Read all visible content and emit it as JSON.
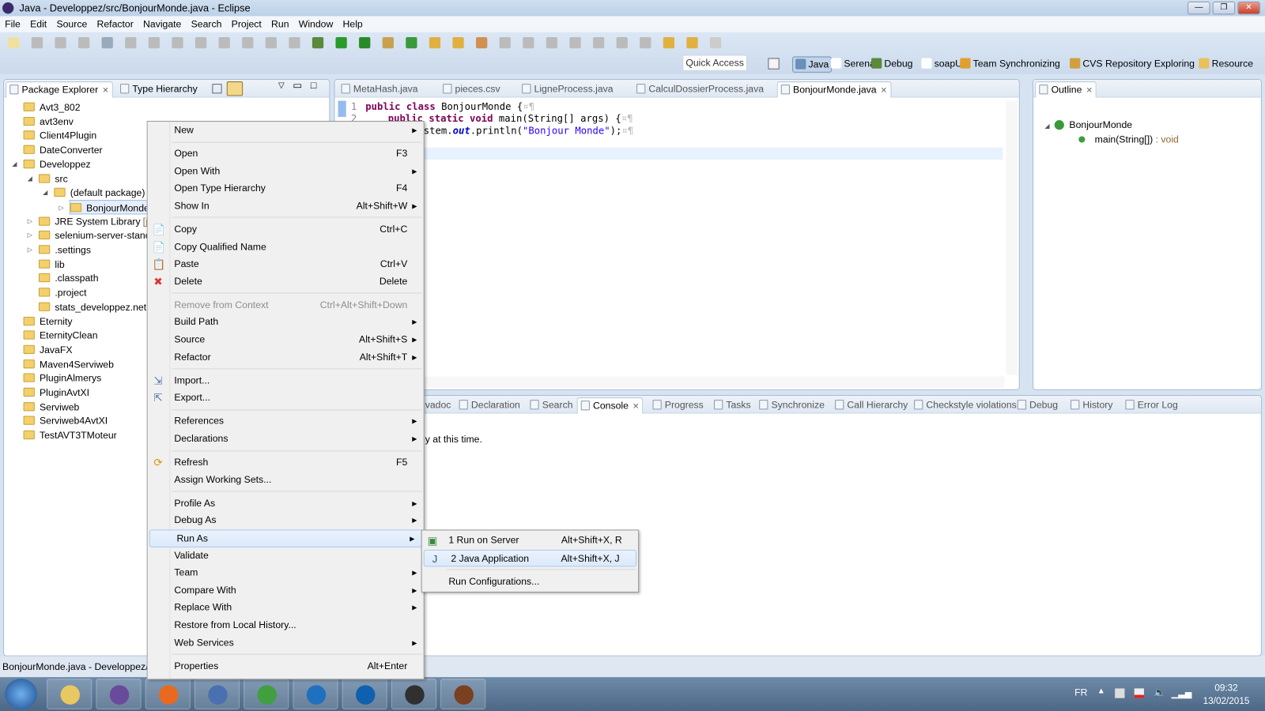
{
  "window": {
    "title": "Java - Developpez/src/BonjourMonde.java - Eclipse",
    "controls": [
      "—",
      "❐",
      "✕"
    ]
  },
  "menubar": [
    "File",
    "Edit",
    "Source",
    "Refactor",
    "Navigate",
    "Search",
    "Project",
    "Run",
    "Window",
    "Help"
  ],
  "quick_access": {
    "placeholder": "Quick Access"
  },
  "perspectives": [
    {
      "label": "Java",
      "active": true,
      "color": "#6a8fb8"
    },
    {
      "label": "Serena",
      "color": "#ffffff"
    },
    {
      "label": "Debug",
      "color": "#5a8a3a"
    },
    {
      "label": "soapUI",
      "color": "#ffffff"
    },
    {
      "label": "Team Synchronizing",
      "color": "#e0a030"
    },
    {
      "label": "CVS Repository Exploring",
      "color": "#d0a040"
    },
    {
      "label": "Resource",
      "color": "#e8c060"
    }
  ],
  "left_panel": {
    "tabs": [
      {
        "label": "Package Explorer",
        "active": true
      },
      {
        "label": "Type Hierarchy"
      }
    ],
    "tree": [
      {
        "label": "Avt3_802",
        "level": 0
      },
      {
        "label": "avt3env",
        "level": 0
      },
      {
        "label": "Client4Plugin",
        "level": 0
      },
      {
        "label": "DateConverter",
        "level": 0
      },
      {
        "label": "Developpez",
        "level": 0,
        "expanded": true
      },
      {
        "label": "src",
        "level": 1,
        "expanded": true
      },
      {
        "label": "(default package)",
        "level": 2,
        "expanded": true
      },
      {
        "label": "BonjourMonde",
        "level": 3,
        "collapsed": true,
        "selected": true
      },
      {
        "label": "JRE System Library",
        "suffix": "[jdk",
        "level": 1,
        "collapsed": true
      },
      {
        "label": "selenium-server-standa",
        "level": 1,
        "collapsed": true
      },
      {
        "label": ".settings",
        "level": 1,
        "collapsed": true
      },
      {
        "label": "lib",
        "level": 1
      },
      {
        "label": ".classpath",
        "level": 1
      },
      {
        "label": ".project",
        "level": 1
      },
      {
        "label": "stats_developpez.net",
        "level": 1
      },
      {
        "label": "Eternity",
        "level": 0
      },
      {
        "label": "EternityClean",
        "level": 0
      },
      {
        "label": "JavaFX",
        "level": 0
      },
      {
        "label": "Maven4Serviweb",
        "level": 0
      },
      {
        "label": "PluginAlmerys",
        "level": 0
      },
      {
        "label": "PluginAvtXI",
        "level": 0
      },
      {
        "label": "Serviweb",
        "level": 0
      },
      {
        "label": "Serviweb4AvtXI",
        "level": 0
      },
      {
        "label": "TestAVT3TMoteur",
        "level": 0
      }
    ]
  },
  "editor": {
    "tabs": [
      {
        "label": "MetaHash.java"
      },
      {
        "label": "pieces.csv"
      },
      {
        "label": "LigneProcess.java"
      },
      {
        "label": "CalculDossierProcess.java"
      },
      {
        "label": "BonjourMonde.java",
        "active": true
      }
    ],
    "line_numbers": [
      "1",
      "2"
    ],
    "code": {
      "l1_kw": "public class",
      "l1_rest": " BonjourMonde {",
      "l2_kw": "public static void",
      "l2_rest": " main(String[] args) {",
      "l3_a": "stem.",
      "l3_out": "out",
      "l3_b": ".println(",
      "l3_str": "\"Bonjour Monde\"",
      "l3_c": ");"
    }
  },
  "outline": {
    "tab": "Outline",
    "class": "BonjourMonde",
    "method": "main(String[])",
    "method_type": " : void"
  },
  "bottom": {
    "tabs": [
      "vadoc",
      "Declaration",
      "Search",
      "Console",
      "Progress",
      "Tasks",
      "Synchronize",
      "Call Hierarchy",
      "Checkstyle violations",
      "Debug",
      "History",
      "Error Log"
    ],
    "active": "Console",
    "message": "y at this time."
  },
  "context_menu": [
    [
      {
        "label": "New",
        "submenu": true
      }
    ],
    [
      {
        "label": "Open",
        "shortcut": "F3"
      },
      {
        "label": "Open With",
        "submenu": true
      },
      {
        "label": "Open Type Hierarchy",
        "shortcut": "F4"
      },
      {
        "label": "Show In",
        "shortcut": "Alt+Shift+W",
        "submenu": true
      }
    ],
    [
      {
        "label": "Copy",
        "shortcut": "Ctrl+C",
        "icon": "copy"
      },
      {
        "label": "Copy Qualified Name",
        "icon": "copy"
      },
      {
        "label": "Paste",
        "shortcut": "Ctrl+V",
        "icon": "paste"
      },
      {
        "label": "Delete",
        "shortcut": "Delete",
        "icon": "delete"
      }
    ],
    [
      {
        "label": "Remove from Context",
        "shortcut": "Ctrl+Alt+Shift+Down",
        "disabled": true
      },
      {
        "label": "Build Path",
        "submenu": true
      },
      {
        "label": "Source",
        "shortcut": "Alt+Shift+S",
        "submenu": true
      },
      {
        "label": "Refactor",
        "shortcut": "Alt+Shift+T",
        "submenu": true
      }
    ],
    [
      {
        "label": "Import...",
        "icon": "import"
      },
      {
        "label": "Export...",
        "icon": "export"
      }
    ],
    [
      {
        "label": "References",
        "submenu": true
      },
      {
        "label": "Declarations",
        "submenu": true
      }
    ],
    [
      {
        "label": "Refresh",
        "shortcut": "F5",
        "icon": "refresh"
      },
      {
        "label": "Assign Working Sets..."
      }
    ],
    [
      {
        "label": "Profile As",
        "submenu": true
      },
      {
        "label": "Debug As",
        "submenu": true
      },
      {
        "label": "Run As",
        "submenu": true,
        "highlighted": true
      },
      {
        "label": "Validate"
      },
      {
        "label": "Team",
        "submenu": true
      },
      {
        "label": "Compare With",
        "submenu": true
      },
      {
        "label": "Replace With",
        "submenu": true
      },
      {
        "label": "Restore from Local History..."
      },
      {
        "label": "Web Services",
        "submenu": true
      }
    ],
    [
      {
        "label": "Properties",
        "shortcut": "Alt+Enter"
      }
    ]
  ],
  "run_as_submenu": [
    [
      {
        "label": "1 Run on Server",
        "shortcut": "Alt+Shift+X, R",
        "icon": "server"
      },
      {
        "label": "2 Java Application",
        "shortcut": "Alt+Shift+X, J",
        "icon": "java",
        "highlighted": true
      }
    ],
    [
      {
        "label": "Run Configurations..."
      }
    ]
  ],
  "status": {
    "text": "BonjourMonde.java - Developpez/"
  },
  "taskbar": {
    "apps": [
      {
        "name": "explorer",
        "color": "#e8c860"
      },
      {
        "name": "eclipse",
        "color": "#6a4a9a"
      },
      {
        "name": "firefox",
        "color": "#e86a20"
      },
      {
        "name": "network",
        "color": "#4a70b0"
      },
      {
        "name": "chrome",
        "color": "#40a040"
      },
      {
        "name": "lync",
        "color": "#2070c0"
      },
      {
        "name": "outlook",
        "color": "#1060b0"
      },
      {
        "name": "console",
        "color": "#303030"
      },
      {
        "name": "java-ee-ide",
        "color": "#7a4020"
      }
    ],
    "language": "FR",
    "time": "09:32",
    "date": "13/02/2015"
  }
}
